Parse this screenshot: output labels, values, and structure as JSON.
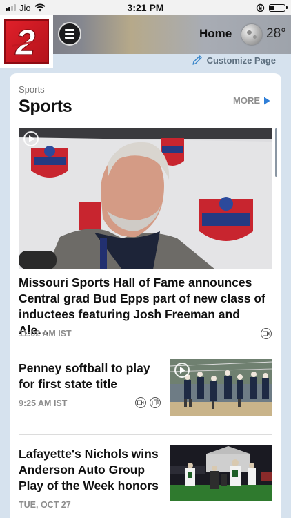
{
  "status": {
    "carrier": "Jio",
    "time": "3:21 PM"
  },
  "header": {
    "logo_label": "2",
    "home_label": "Home",
    "temperature": "28°",
    "weather_icon": "moon-icon"
  },
  "customize_label": "Customize Page",
  "section": {
    "eyebrow": "Sports",
    "title": "Sports",
    "more_label": "MORE"
  },
  "hero_story": {
    "headline": "Missouri Sports Hall of Fame announces Central grad Bud Epps part of new class of inductees featuring Josh Freeman and Ale…",
    "time": "11:02 AM IST"
  },
  "stories": [
    {
      "title": "Penney softball to play for first state title",
      "time": "9:25 AM IST"
    },
    {
      "title": "Lafayette's Nichols wins Anderson Auto Group Play of the Week honors",
      "time": "TUE, OCT 27"
    }
  ],
  "colors": {
    "brand_red": "#d31f2a",
    "accent_blue": "#2f7fd8"
  }
}
